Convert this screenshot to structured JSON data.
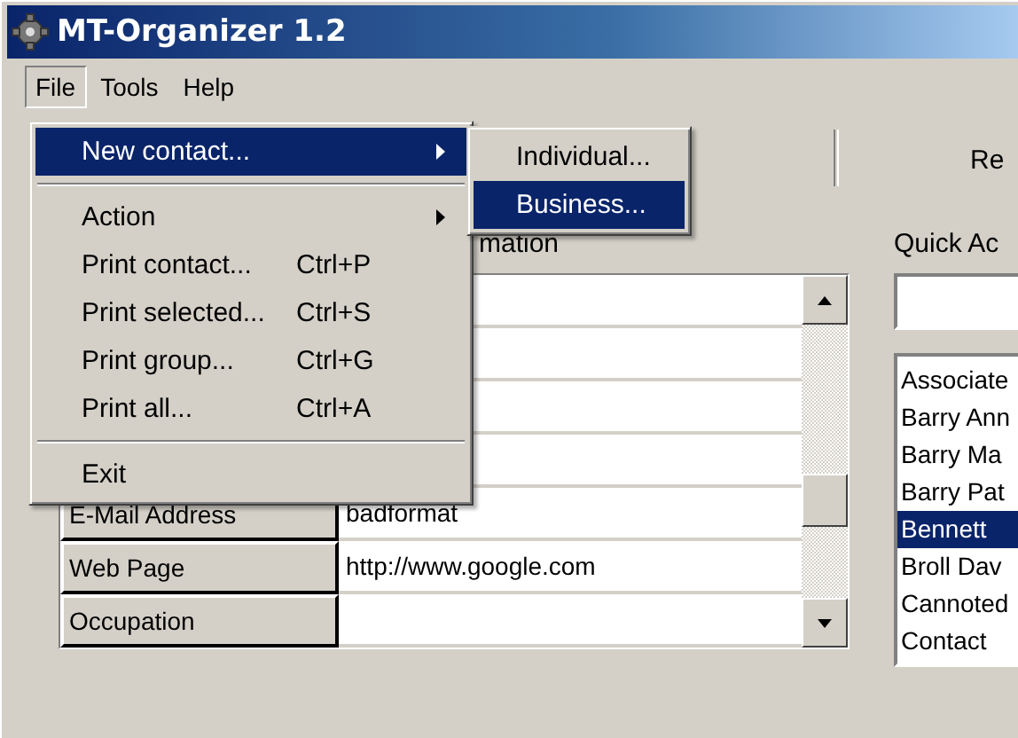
{
  "window": {
    "title": "MT-Organizer 1.2"
  },
  "menubar": [
    {
      "label": "File",
      "selected": true
    },
    {
      "label": "Tools",
      "selected": false
    },
    {
      "label": "Help",
      "selected": false
    }
  ],
  "toolbar": {
    "label": "Re"
  },
  "details": {
    "heading": "mation",
    "rows": [
      {},
      {},
      {},
      {},
      {
        "label": "E-Mail Address",
        "value": "badformat"
      },
      {
        "label": "Web Page",
        "value": "http://www.google.com"
      },
      {
        "label": "Occupation"
      }
    ]
  },
  "quick_access": {
    "label": "Quick Ac",
    "items": [
      {
        "label": "Associate",
        "selected": false
      },
      {
        "label": "Barry Ann",
        "selected": false
      },
      {
        "label": "Barry Ma",
        "selected": false
      },
      {
        "label": "Barry Pat",
        "selected": false
      },
      {
        "label": "Bennett",
        "selected": true
      },
      {
        "label": "Broll Dav",
        "selected": false
      },
      {
        "label": "Cannoted",
        "selected": false
      },
      {
        "label": "Contact",
        "selected": false
      }
    ]
  },
  "file_menu": [
    {
      "kind": "item",
      "label": "New contact...",
      "submenu": true,
      "selected": true
    },
    {
      "kind": "separator"
    },
    {
      "kind": "item",
      "label": "Action",
      "submenu": true,
      "selected": false
    },
    {
      "kind": "item",
      "label": "Print contact...",
      "shortcut": "Ctrl+P",
      "selected": false
    },
    {
      "kind": "item",
      "label": "Print selected...",
      "shortcut": "Ctrl+S",
      "selected": false
    },
    {
      "kind": "item",
      "label": "Print group...",
      "shortcut": "Ctrl+G",
      "selected": false
    },
    {
      "kind": "item",
      "label": "Print all...",
      "shortcut": "Ctrl+A",
      "selected": false
    },
    {
      "kind": "separator"
    },
    {
      "kind": "item",
      "label": "Exit",
      "selected": false
    }
  ],
  "submenu": [
    {
      "kind": "item",
      "label": "Individual...",
      "selected": false
    },
    {
      "kind": "item",
      "label": "Business...",
      "selected": true
    }
  ]
}
